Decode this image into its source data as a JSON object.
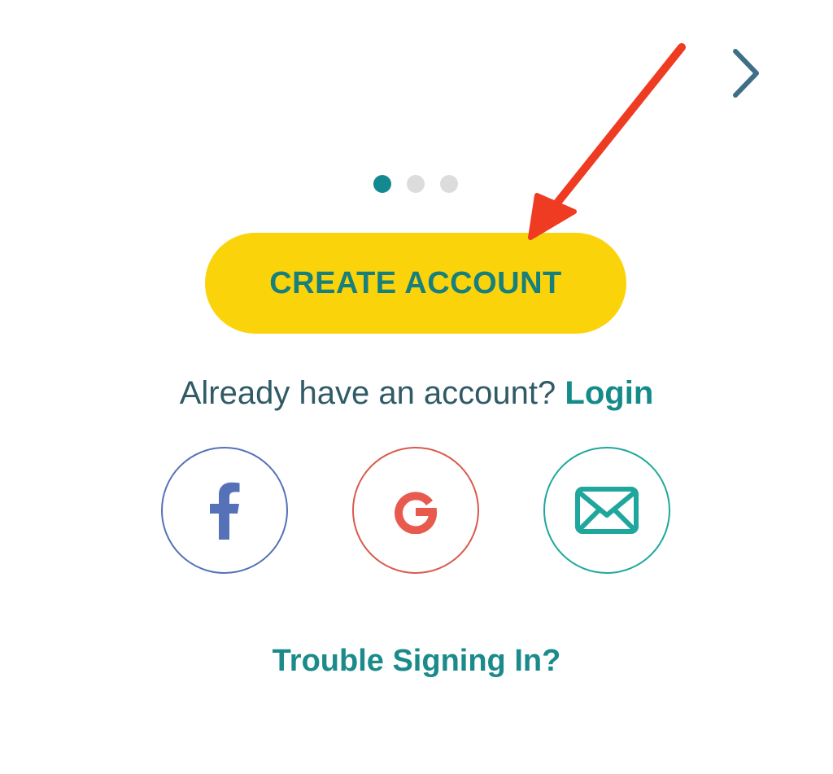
{
  "colors": {
    "accent_yellow": "#fbd30b",
    "teal": "#148b8a",
    "text_dark": "#2f5a66",
    "facebook_blue": "#5571b8",
    "google_red": "#d9594c",
    "email_teal": "#1fa79d",
    "annotation_red": "#ee3b22"
  },
  "header": {
    "next_icon": "chevron-right-icon"
  },
  "carousel": {
    "page_count": 3,
    "active_page": 1
  },
  "actions": {
    "create_account_label": "CREATE ACCOUNT",
    "login_prompt": "Already have an account?",
    "login_label": "Login",
    "trouble_label": "Trouble Signing In?"
  },
  "social_login": [
    {
      "provider": "facebook",
      "icon": "facebook-icon"
    },
    {
      "provider": "google",
      "icon": "google-icon"
    },
    {
      "provider": "email",
      "icon": "mail-icon"
    }
  ],
  "annotation": {
    "type": "arrow",
    "icon": "red-arrow-icon",
    "points_to": "create-account-button"
  }
}
